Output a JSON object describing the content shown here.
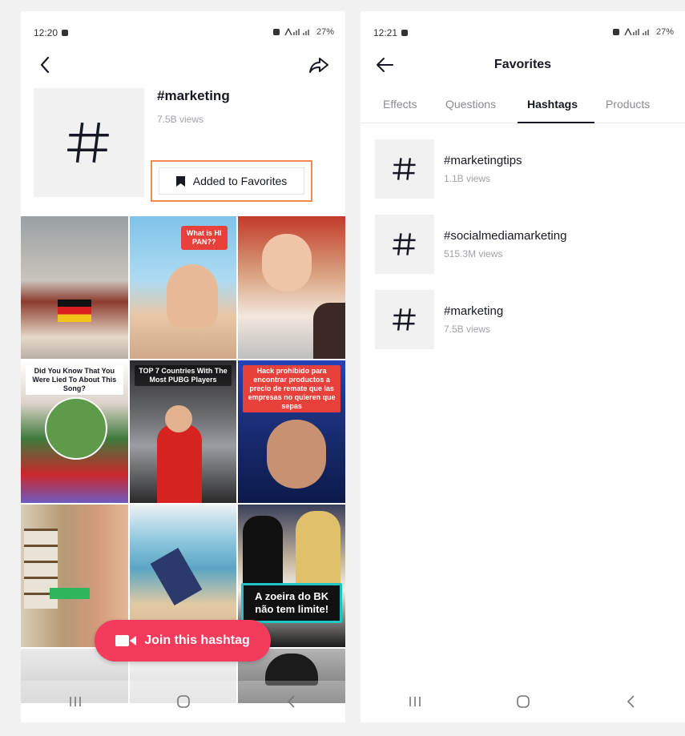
{
  "left_screen": {
    "status_time": "12:20",
    "status_battery": "27%",
    "status_signal": "ⵌ ⅋ ᴿ ⏗",
    "hashtag": {
      "name": "#marketing",
      "views": "7.5B views",
      "favorite_button_label": "Added to Favorites"
    },
    "grid_captions": {
      "cell_1": "What is HI PAN??",
      "cell_3": "Did You Know That You Were Lied To About This Song?",
      "cell_4": "TOP 7 Countries With The Most PUBG Players",
      "cell_5": "Hack prohibido para encontrar productos a precio de remate que las empresas no quieren que sepas",
      "cell_8": "A zoeira do BK não tem limite!"
    },
    "join_button_label": "Join this hashtag"
  },
  "right_screen": {
    "status_time": "12:21",
    "status_battery": "27%",
    "title": "Favorites",
    "tabs": [
      {
        "label": "Effects",
        "active": false
      },
      {
        "label": "Questions",
        "active": false
      },
      {
        "label": "Hashtags",
        "active": true
      },
      {
        "label": "Products",
        "active": false
      }
    ],
    "hashtags": [
      {
        "name": "#marketingtips",
        "views": "1.1B views"
      },
      {
        "name": "#socialmediamarketing",
        "views": "515.3M views"
      },
      {
        "name": "#marketing",
        "views": "7.5B views"
      }
    ]
  },
  "icons": {
    "back": "arrow-back-icon",
    "share": "share-arrow-icon",
    "hashtag": "hashtag-icon",
    "bookmark": "bookmark-icon",
    "camera": "video-camera-icon"
  },
  "colors": {
    "accent_red": "#f43b5c",
    "highlight_orange": "#ee8a4a",
    "text_primary": "#161823",
    "text_secondary": "#a1a2a7"
  }
}
